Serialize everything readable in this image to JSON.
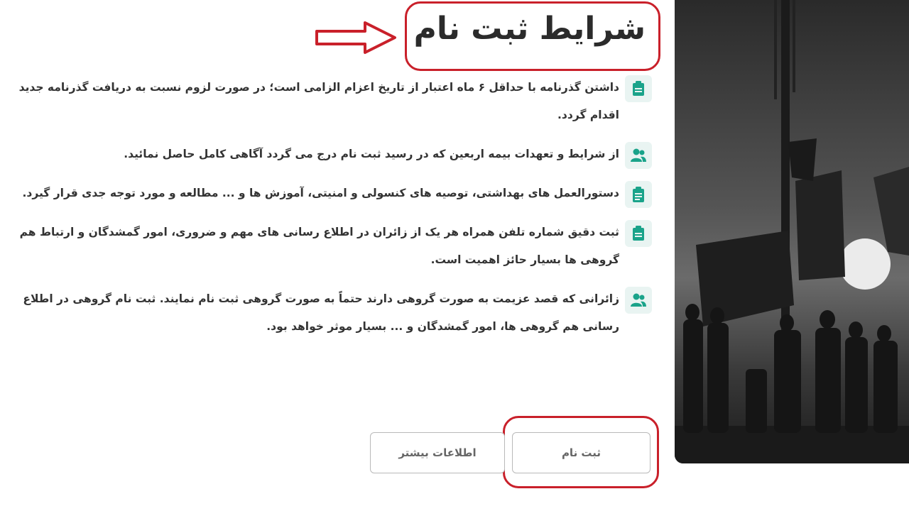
{
  "title": "شرایط ثبت نام",
  "requirements": [
    {
      "icon": "passport-icon",
      "text": "داشتن گذرنامه با حداقل ۶ ماه اعتبار از تاریخ اعزام الزامی است؛ در صورت لزوم نسبت به دریافت گذرنامه جدید اقدام گردد."
    },
    {
      "icon": "users-icon",
      "text": "از شرایط و تعهدات بیمه اربعین که در رسید ثبت نام درج می گردد آگاهی کامل حاصل نمائید."
    },
    {
      "icon": "clipboard-icon",
      "text": "دستورالعمل های بهداشتی، توصیه های کنسولی و امنیتی، آموزش ها و ... مطالعه و مورد توجه جدی قرار گیرد."
    },
    {
      "icon": "passport-icon",
      "text": "ثبت دقیق شماره تلفن همراه هر یک از زائران در اطلاع رسانی های مهم و ضروری، امور گمشدگان و ارتباط هم گروهی ها بسیار حائز اهمیت است."
    },
    {
      "icon": "users-icon",
      "text": "زائرانی که قصد عزیمت به صورت گروهی دارند حتماً به صورت گروهی ثبت نام نمایند. ثبت نام گروهی در اطلاع رسانی هم گروهی ها، امور گمشدگان و ... بسیار موثر خواهد بود."
    }
  ],
  "buttons": {
    "register": "ثبت نام",
    "more_info": "اطلاعات بیشتر"
  },
  "colors": {
    "accent": "#1aa38a",
    "icon_bg": "#e9f4f2",
    "highlight": "#c9202a"
  }
}
